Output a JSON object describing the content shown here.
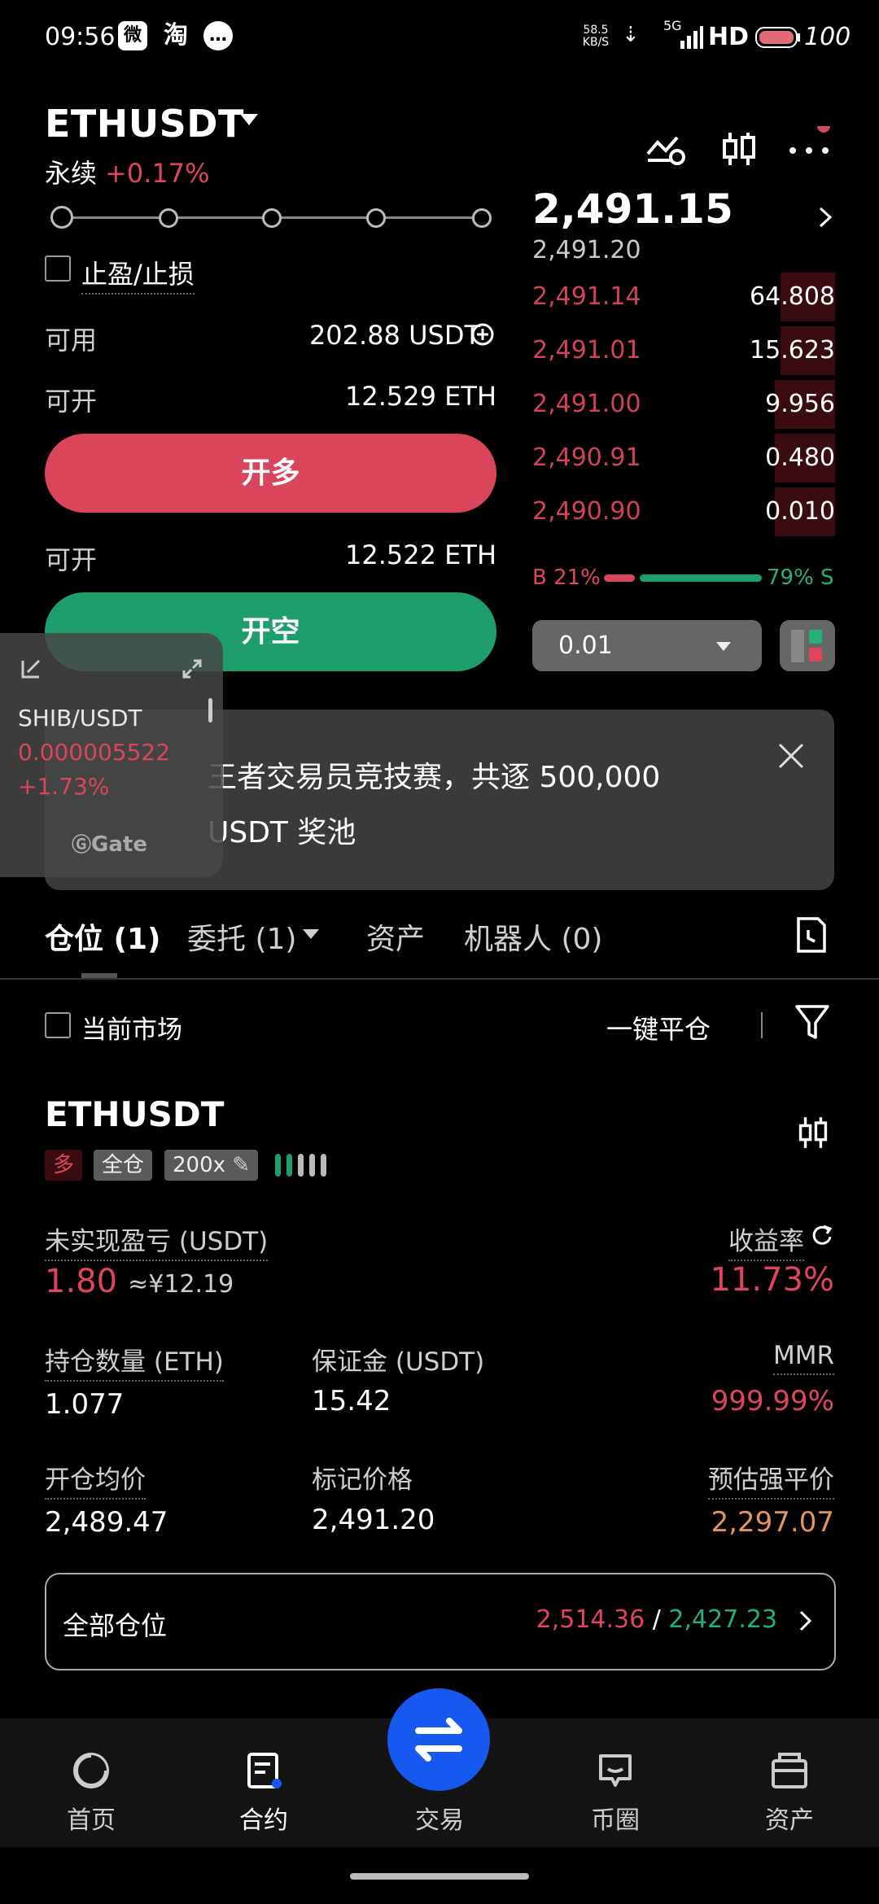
{
  "status": {
    "time": "09:56",
    "net_speed": "58.5 KB/S",
    "signal": "5G",
    "hd": "HD",
    "battery": "100"
  },
  "header": {
    "pair": "ETHUSDT",
    "contract_type": "永续",
    "change": "+0.17%"
  },
  "order_form": {
    "tpsl_label": "止盈/止损",
    "available_label": "可用",
    "available_value": "202.88 USDT",
    "open_long_label": "可开",
    "open_long_value": "12.529 ETH",
    "long_button": "开多",
    "open_short_label": "可开",
    "open_short_value": "12.522 ETH",
    "short_button": "开空"
  },
  "order_book": {
    "last_price": "2,491.15",
    "mark_price": "2,491.20",
    "asks": [
      {
        "price": "2,491.14",
        "qty": "64.808",
        "depth": 0.18
      },
      {
        "price": "2,491.01",
        "qty": "15.623",
        "depth": 0.18
      },
      {
        "price": "2,491.00",
        "qty": "9.956",
        "depth": 0.2
      },
      {
        "price": "2,490.91",
        "qty": "0.480",
        "depth": 0.2
      },
      {
        "price": "2,490.90",
        "qty": "0.010",
        "depth": 0.2
      }
    ],
    "buy_ratio": "B 21%",
    "sell_ratio": "79% S",
    "qty_step": "0.01"
  },
  "banner": {
    "text": "王者交易员竞技赛，共逐 500,000 USDT 奖池"
  },
  "floating_ticker": {
    "symbol": "SHIB/USDT",
    "price": "0.000005522",
    "change": "+1.73%",
    "brand": "Gate"
  },
  "tabs": [
    {
      "label": "仓位 (1)"
    },
    {
      "label": "委托 (1)"
    },
    {
      "label": "资产"
    },
    {
      "label": "机器人 (0)"
    }
  ],
  "filters": {
    "current_market": "当前市场",
    "close_all": "一键平仓"
  },
  "position": {
    "symbol": "ETHUSDT",
    "side": "多",
    "margin_mode": "全仓",
    "leverage": "200x",
    "pnl_label": "未实现盈亏 (USDT)",
    "pnl_value": "1.80",
    "pnl_cny": "≈¥12.19",
    "roe_label": "收益率",
    "roe_value": "11.73%",
    "size_label": "持仓数量 (ETH)",
    "size_value": "1.077",
    "margin_label": "保证金 (USDT)",
    "margin_value": "15.42",
    "mmr_label": "MMR",
    "mmr_value": "999.99%",
    "entry_label": "开仓均价",
    "entry_value": "2,489.47",
    "markp_label": "标记价格",
    "markp_value": "2,491.20",
    "liq_label": "预估强平价",
    "liq_value": "2,297.07"
  },
  "all_positions": {
    "label": "全部仓位",
    "tp": "2,514.36",
    "sep": "/",
    "sl": "2,427.23"
  },
  "nav": [
    {
      "label": "首页"
    },
    {
      "label": "合约"
    },
    {
      "label": "交易"
    },
    {
      "label": "币圈"
    },
    {
      "label": "资产"
    }
  ]
}
